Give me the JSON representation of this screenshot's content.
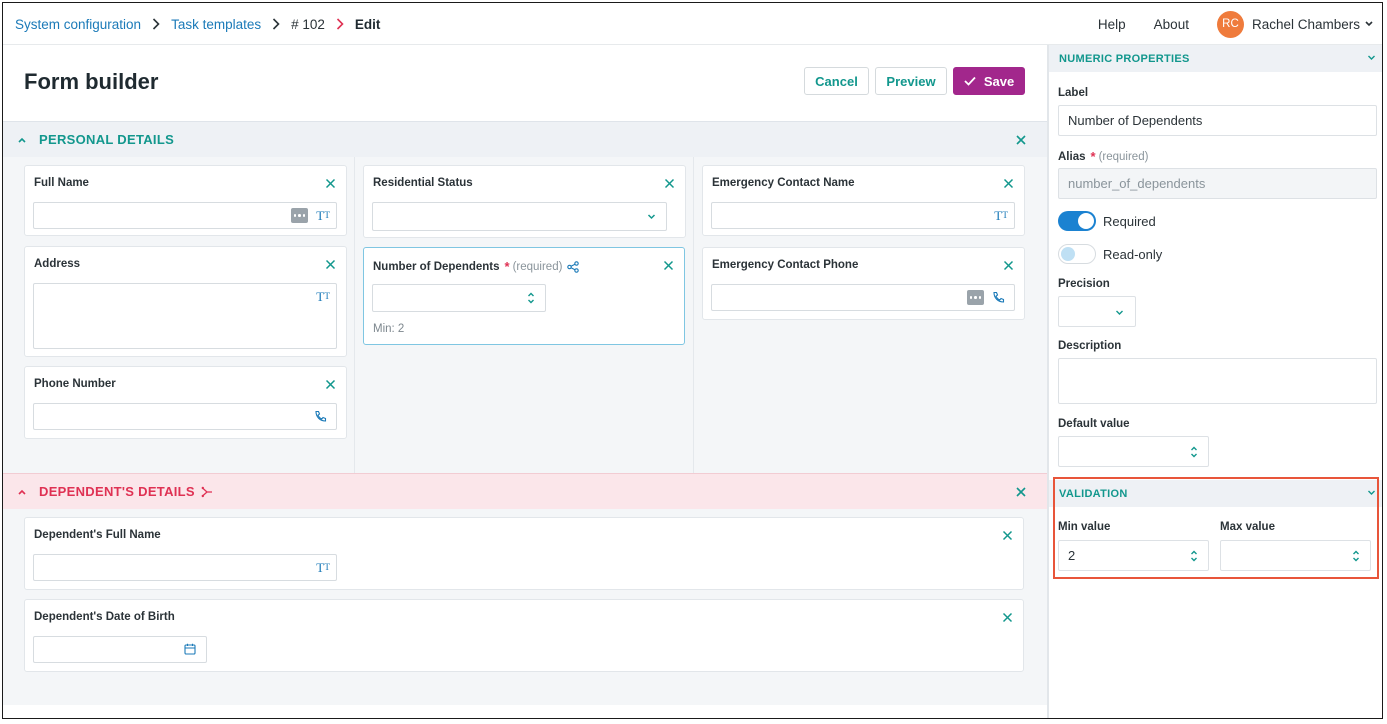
{
  "breadcrumb": {
    "items": [
      "System configuration",
      "Task templates",
      "# 102",
      "Edit"
    ]
  },
  "header": {
    "help": "Help",
    "about": "About",
    "user_initials": "RC",
    "user_name": "Rachel Chambers",
    "avatar_color": "#ef7b3c"
  },
  "page": {
    "title": "Form builder",
    "cancel_label": "Cancel",
    "preview_label": "Preview",
    "save_label": "Save"
  },
  "sections": {
    "personal": {
      "title": "PERSONAL DETAILS",
      "fields": {
        "full_name": "Full Name",
        "address": "Address",
        "phone_number": "Phone Number",
        "residential_status": "Residential Status",
        "number_of_dependents": "Number of Dependents",
        "required_hint": "(required)",
        "required_star": "*",
        "min_hint": "Min: 2",
        "emergency_contact_name": "Emergency Contact Name",
        "emergency_contact_phone": "Emergency Contact Phone"
      }
    },
    "dependent": {
      "title": "DEPENDENT'S DETAILS",
      "fields": {
        "full_name": "Dependent's Full Name",
        "date_of_birth": "Dependent's Date of Birth"
      }
    }
  },
  "panel": {
    "numeric_title": "NUMERIC PROPERTIES",
    "label_label": "Label",
    "label_value": "Number of Dependents",
    "alias_label": "Alias",
    "alias_star": "*",
    "alias_hint": "(required)",
    "alias_value": "number_of_dependents",
    "required_label": "Required",
    "required_on": true,
    "readonly_label": "Read-only",
    "readonly_on": false,
    "precision_label": "Precision",
    "description_label": "Description",
    "default_label": "Default value",
    "validation_title": "VALIDATION",
    "min_label": "Min value",
    "min_value": "2",
    "max_label": "Max value"
  },
  "colors": {
    "teal": "#12978d",
    "link_blue": "#1b7ab8",
    "save_purple": "#a2278c",
    "danger_red": "#df3153",
    "highlight_orange": "#e8553a"
  }
}
